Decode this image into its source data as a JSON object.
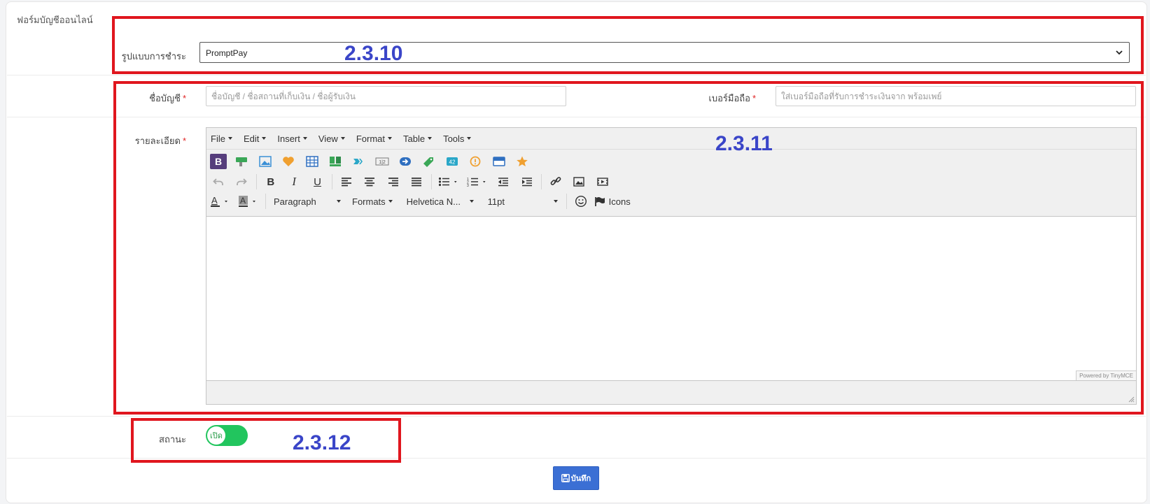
{
  "form_title": "ฟอร์มบัญชีออนไลน์",
  "payment": {
    "label": "รูปแบบการชำระ",
    "selected": "PromptPay"
  },
  "account": {
    "name_label": "ชื่อบัญชี",
    "name_placeholder": "ชื่อบัญชี / ชื่อสถานที่เก็บเงิน / ชื่อผู้รับเงิน",
    "phone_label": "เบอร์มือถือ",
    "phone_placeholder": "ใส่เบอร์มือถือที่รับการชำระเงินจาก พร้อมเพย์",
    "required_mark": "*"
  },
  "details": {
    "label": "รายละเอียด"
  },
  "editor": {
    "menus": [
      "File",
      "Edit",
      "Insert",
      "View",
      "Format",
      "Table",
      "Tools"
    ],
    "block_format": "Paragraph",
    "formats": "Formats",
    "font_family": "Helvetica N...",
    "font_size": "11pt",
    "icons_label": "Icons",
    "powered_by": "Powered by TinyMCE"
  },
  "status": {
    "label": "สถานะ",
    "toggle_text": "เปิด",
    "on": true
  },
  "save_label": "บันทึก",
  "annotations": [
    "2.3.10",
    "2.3.11",
    "2.3.12"
  ],
  "colors": {
    "annotation_box": "#e0161e",
    "annotation_text": "#3a45c8",
    "toggle_on": "#22c55e",
    "save_button": "#3b6fd4"
  }
}
